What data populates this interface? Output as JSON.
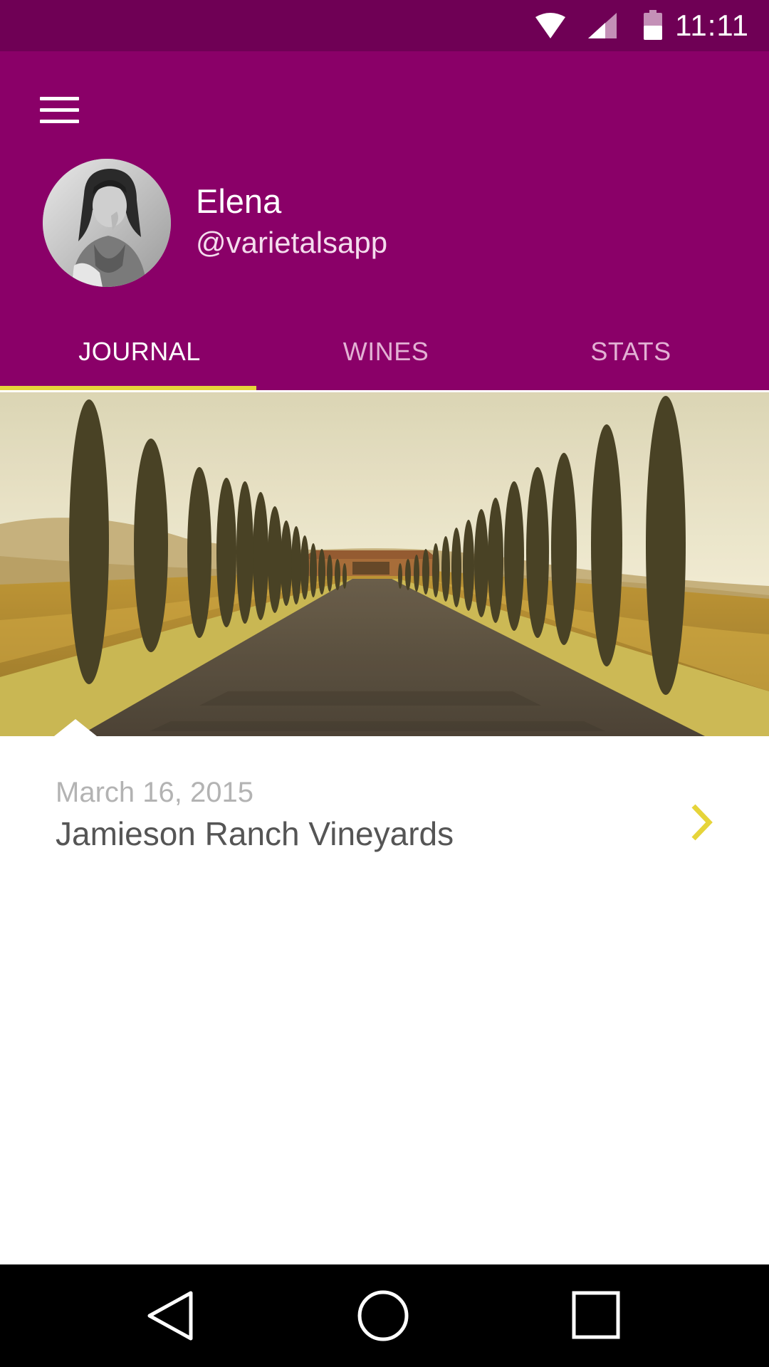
{
  "theme": {
    "status_bar_color": "#6f0055",
    "primary_color": "#8a0068",
    "accent_color": "#e6d43a",
    "tab_inactive_color": "#e3b1d4"
  },
  "status_bar": {
    "time": "11:11",
    "icons": [
      "wifi-icon",
      "cell-signal-icon",
      "battery-icon"
    ]
  },
  "header": {
    "menu_icon": "hamburger-menu-icon",
    "profile": {
      "name": "Elena",
      "handle": "@varietalsapp",
      "avatar": "user-avatar-photo"
    }
  },
  "tabs": [
    {
      "label": "JOURNAL",
      "selected": true
    },
    {
      "label": "WINES",
      "selected": false
    },
    {
      "label": "STATS",
      "selected": false
    }
  ],
  "journal": {
    "entries": [
      {
        "date": "March 16, 2015",
        "title": "Jamieson Ranch Vineyards",
        "image": "vineyard-road-cypress-trees-photo",
        "chevron_icon": "chevron-right-icon"
      }
    ]
  },
  "nav_bar": {
    "icons": [
      "back-icon",
      "home-icon",
      "recents-icon"
    ]
  }
}
